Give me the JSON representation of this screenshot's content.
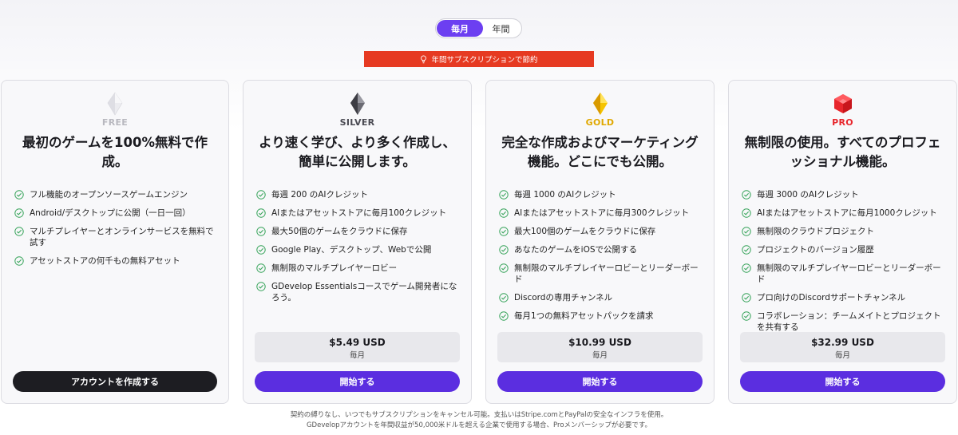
{
  "billing_toggle": {
    "monthly": "毎月",
    "yearly": "年間"
  },
  "banner": {
    "text": "年間サブスクリプションで節約"
  },
  "plans": [
    {
      "tier": "FREE",
      "tier_color": "#b8b8bf",
      "gem_icon": "diamond-clear-icon",
      "headline": "最初のゲームを100%無料で作成。",
      "features": [
        "フル機能のオープンソースゲームエンジン",
        "Android/デスクトップに公開（一日一回）",
        "マルチプレイヤーとオンラインサービスを無料で試す",
        "アセットストアの何千もの無料アセット"
      ],
      "cta": "アカウントを作成する"
    },
    {
      "tier": "SILVER",
      "tier_color": "#4a4a52",
      "gem_icon": "diamond-silver-icon",
      "headline": "より速く学び、より多く作成し、簡単に公開します。",
      "features": [
        "毎週 200 のAIクレジット",
        "AIまたはアセットストアに毎月100クレジット",
        "最大50個のゲームをクラウドに保存",
        "Google Play、デスクトップ、Webで公開",
        "無制限のマルチプレイヤーロビー",
        "GDevelop Essentialsコースでゲーム開発者になろう。"
      ],
      "price": "$5.49 USD",
      "period": "毎月",
      "cta": "開始する"
    },
    {
      "tier": "GOLD",
      "tier_color": "#e0a800",
      "gem_icon": "diamond-gold-icon",
      "headline": "完全な作成およびマーケティング機能。どこにでも公開。",
      "features": [
        "毎週 1000 のAIクレジット",
        "AIまたはアセットストアに毎月300クレジット",
        "最大100個のゲームをクラウドに保存",
        "あなたのゲームをiOSで公開する",
        "無制限のマルチプレイヤーロビーとリーダーボード",
        "Discordの専用チャンネル",
        "毎月1つの無料アセットパックを請求"
      ],
      "price": "$10.99 USD",
      "period": "毎月",
      "cta": "開始する"
    },
    {
      "tier": "PRO",
      "tier_color": "#e8262c",
      "gem_icon": "gem-red-icon",
      "headline": "無制限の使用。すべてのプロフェッショナル機能。",
      "features": [
        "毎週 3000 のAIクレジット",
        "AIまたはアセットストアに毎月1000クレジット",
        "無制限のクラウドプロジェクト",
        "プロジェクトのバージョン履歴",
        "無制限のマルチプレイヤーロビーとリーダーボード",
        "プロ向けのDiscordサポートチャンネル",
        "コラボレーション：チームメイトとプロジェクトを共有する"
      ],
      "price": "$32.99 USD",
      "period": "毎月",
      "cta": "開始する"
    }
  ],
  "footer": {
    "line1": "契約の縛りなし、いつでもサブスクリプションをキャンセル可能。支払いはStripe.comとPayPalの安全なインフラを使用。",
    "line2": "GDevelopアカウントを年間収益が50,000米ドルを超える企業で使用する場合、Proメンバーシップが必要です。"
  },
  "colors": {
    "accent": "#6c3ff1",
    "cta_purple": "#5b2ee0",
    "cta_dark": "#1d1d22",
    "banner": "#e63a22",
    "check": "#3aa55d"
  }
}
